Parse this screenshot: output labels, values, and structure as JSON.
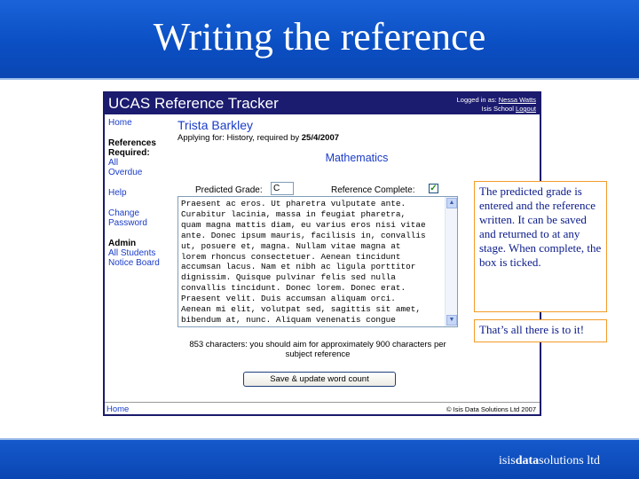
{
  "slide": {
    "title": "Writing the reference",
    "brand_prefix": "isis",
    "brand_bold": "data",
    "brand_suffix": "solutions ltd"
  },
  "app": {
    "title": "UCAS Reference Tracker",
    "logged_in_label": "Logged in as:",
    "user_name": "Nessa Watts",
    "school": "Isis School",
    "logout_label": "Logout",
    "sidebar": {
      "home": "Home",
      "references_heading": "References Required:",
      "all": "All",
      "overdue": "Overdue",
      "help": "Help",
      "change_password": "Change Password",
      "admin_heading": "Admin",
      "all_students": "All Students",
      "notice_board": "Notice Board"
    },
    "student_name": "Trista Barkley",
    "applying_prefix": "Applying for: History, required by",
    "required_date": "25/4/2007",
    "subject": "Mathematics",
    "predicted_grade_label": "Predicted Grade:",
    "predicted_grade_value": "C",
    "reference_complete_label": "Reference Complete:",
    "reference_complete": true,
    "reference_text": "Praesent ac eros. Ut pharetra vulputate ante.\nCurabitur lacinia, massa in feugiat pharetra,\nquam magna mattis diam, eu varius eros nisi vitae\nante. Donec ipsum mauris, facilisis in, convallis\nut, posuere et, magna. Nullam vitae magna at\nlorem rhoncus consectetuer. Aenean tincidunt\naccumsan lacus. Nam et nibh ac ligula porttitor\ndignissim. Quisque pulvinar felis sed nulla\nconvallis tincidunt. Donec lorem. Donec erat.\nPraesent velit. Duis accumsan aliquam orci.\nAenean mi elit, volutpat sed, sagittis sit amet,\nbibendum at, nunc. Aliquam venenatis congue",
    "char_count_text": "853 characters: you should aim for approximately 900 characters per subject reference",
    "save_button": "Save & update word count",
    "footer_home": "Home",
    "footer_copyright": "© Isis Data Solutions Ltd 2007"
  },
  "callouts": {
    "first": "The predicted grade is entered and the reference written. It can be saved and returned to at any stage. When complete, the box is ticked.",
    "second": "That’s all there is to it!"
  },
  "colors": {
    "header_blue": "#0b4fc4",
    "app_titlebar": "#1b1b70",
    "link_blue": "#1a3cc8",
    "callout_border": "#f39c2a",
    "callout_text": "#0a1a8a"
  }
}
